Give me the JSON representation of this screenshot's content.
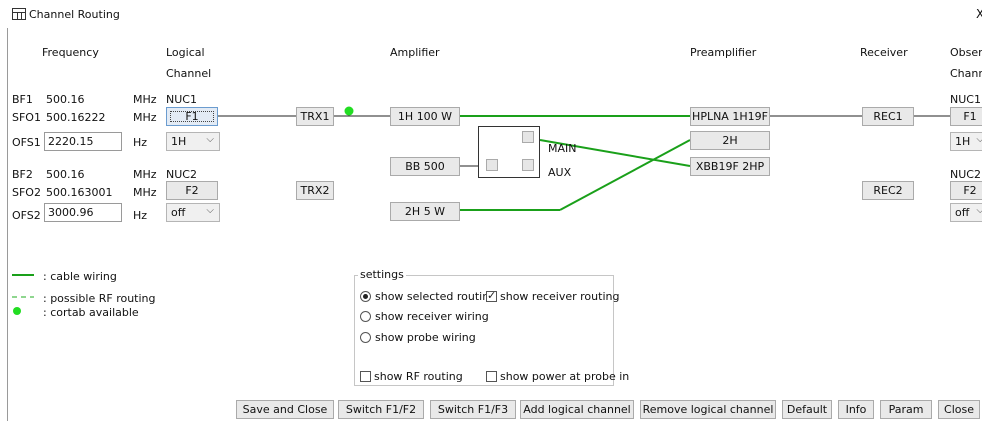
{
  "window": {
    "title": "Channel Routing",
    "close_glyph": "X"
  },
  "headers": {
    "frequency": "Frequency",
    "logical_line1": "Logical",
    "logical_line2": "Channel",
    "amplifier": "Amplifier",
    "preamplifier": "Preamplifier",
    "receiver": "Receiver",
    "observe_line1": "Observ",
    "observe_line2": "Channe"
  },
  "channel1": {
    "bf_label": "BF1",
    "bf_value": "500.16",
    "bf_unit": "MHz",
    "nuc": "NUC1",
    "sfo_label": "SFO1",
    "sfo_value": "500.16222",
    "sfo_unit": "MHz",
    "f_button": "F1",
    "ofs_label": "OFS1",
    "ofs_value": "2220.15",
    "ofs_unit": "Hz",
    "combo": "1H",
    "trx": "TRX1",
    "amp": "1H 100 W",
    "preamp": "HPLNA 1H19F",
    "rec": "REC1",
    "obs_nuc": "NUC1",
    "obs_f": "F1",
    "obs_combo": "1H"
  },
  "channel2": {
    "bf_label": "BF2",
    "bf_value": "500.16",
    "bf_unit": "MHz",
    "nuc": "NUC2",
    "sfo_label": "SFO2",
    "sfo_value": "500.163001",
    "sfo_unit": "MHz",
    "f_button": "F2",
    "ofs_label": "OFS2",
    "ofs_value": "3000.96",
    "ofs_unit": "Hz",
    "combo": "off",
    "trx": "TRX2",
    "rec": "REC2",
    "obs_nuc": "NUC2",
    "obs_f": "F2",
    "obs_combo": "off"
  },
  "amplifiers": {
    "bb": "BB 500",
    "amp2h": "2H 5 W",
    "main": "MAIN",
    "aux": "AUX"
  },
  "preamps": {
    "p2h": "2H",
    "xbb": "XBB19F 2HP"
  },
  "legend": {
    "cable": ": cable wiring",
    "rf": ": possible RF routing",
    "cortab": ": cortab available"
  },
  "settings": {
    "title": "settings",
    "show_selected_routing": "show selected routing",
    "show_receiver_routing": "show receiver routing",
    "show_receiver_wiring": "show receiver wiring",
    "show_probe_wiring": "show probe wiring",
    "show_rf_routing": "show RF routing",
    "show_power_at_probe": "show power at probe in"
  },
  "buttons": {
    "save_close": "Save and Close",
    "switch_f1f2": "Switch F1/F2",
    "switch_f1f3": "Switch F1/F3",
    "add_logical": "Add logical channel",
    "remove_logical": "Remove logical channel",
    "default": "Default",
    "info": "Info",
    "param": "Param",
    "close": "Close"
  },
  "colors": {
    "wire": "#1aa01a",
    "cortab": "#22dd22",
    "selected_border": "#6b9ccf"
  }
}
